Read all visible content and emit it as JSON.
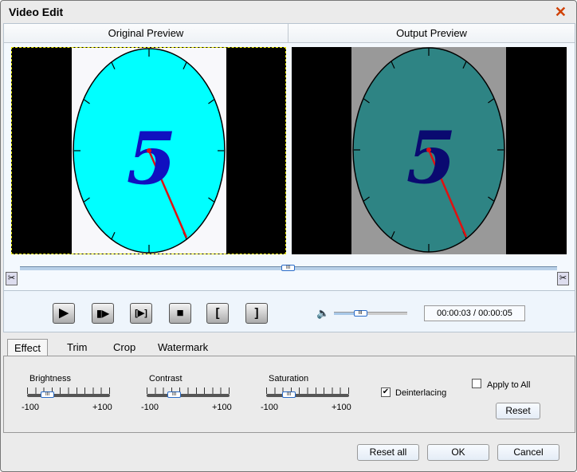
{
  "window": {
    "title": "Video Edit",
    "close_icon": "close-icon"
  },
  "preview": {
    "original_label": "Original Preview",
    "output_label": "Output Preview",
    "overlay_number": "5",
    "colors": {
      "original_face": "#00ffff",
      "output_face": "#2e8484",
      "original_bg": "#f8f8fb",
      "output_bg": "#999999",
      "digit": "#1010c0",
      "output_digit": "#0a0a70",
      "hand": "#e01010"
    },
    "seek_position": 0.5
  },
  "controls": {
    "buttons": [
      "play",
      "next-frame",
      "play-selection",
      "stop",
      "mark-in",
      "mark-out"
    ],
    "button_glyphs": [
      "▶",
      "▮▶",
      "[▶]",
      "■",
      "[",
      "]"
    ],
    "volume": 0.3,
    "time": "00:00:03 / 00:00:05"
  },
  "tabs": [
    {
      "label": "Effect",
      "active": true
    },
    {
      "label": "Trim"
    },
    {
      "label": "Crop"
    },
    {
      "label": "Watermark"
    }
  ],
  "effect": {
    "sliders": [
      {
        "label": "Brightness",
        "min": "-100",
        "max": "+100",
        "value_fraction": 0.24
      },
      {
        "label": "Contrast",
        "min": "-100",
        "max": "+100",
        "value_fraction": 0.33
      },
      {
        "label": "Saturation",
        "min": "-100",
        "max": "+100",
        "value_fraction": 0.27
      }
    ],
    "deinterlacing": {
      "label": "Deinterlacing",
      "checked": true
    },
    "apply_all": {
      "label": "Apply to All",
      "checked": false
    },
    "reset_label": "Reset"
  },
  "footer": {
    "reset_all": "Reset all",
    "ok": "OK",
    "cancel": "Cancel"
  }
}
